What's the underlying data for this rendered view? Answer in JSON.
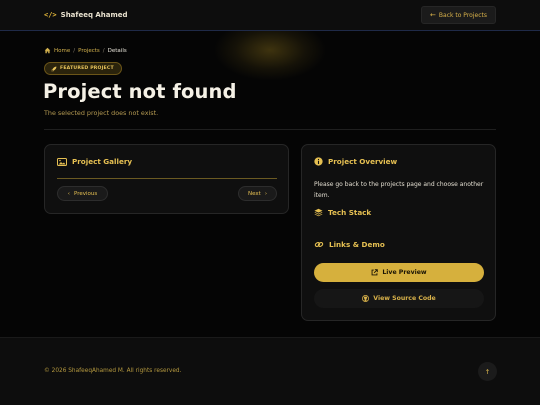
{
  "header": {
    "brand_icon": "</>",
    "brand_name": "Shafeeq Ahamed",
    "back_label": "Back to Projects",
    "back_icon": "←"
  },
  "breadcrumb": {
    "home": "Home",
    "projects": "Projects",
    "current": "Details",
    "separator": "/"
  },
  "badge": {
    "label": "FEATURED PROJECT",
    "icon": "🚀"
  },
  "page": {
    "title": "Project not found",
    "subtitle": "The selected project does not exist."
  },
  "gallery": {
    "heading": "Project Gallery",
    "prev_label": "Previous",
    "next_label": "Next",
    "prev_icon": "‹",
    "next_icon": "›"
  },
  "overview": {
    "heading": "Project Overview",
    "text": "Please go back to the projects page and choose another item.",
    "tech_heading": "Tech Stack",
    "links_heading": "Links & Demo",
    "live_label": "Live Preview",
    "source_label": "View Source Code"
  },
  "footer": {
    "copyright": "© 2026 ShafeeqAhamed M. All rights reserved.",
    "top_icon": "↑"
  },
  "colors": {
    "accent": "#d6b03d",
    "background": "#050505",
    "card": "#0f0f0f"
  }
}
